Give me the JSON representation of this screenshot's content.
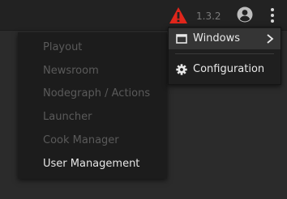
{
  "topbar": {
    "version": "1.3.2",
    "icons": {
      "warning": "warning-triangle-icon",
      "account": "account-circle-icon",
      "more": "more-vertical-icon"
    },
    "colors": {
      "warning": "#e0261b",
      "version_text": "#7a7a7a"
    }
  },
  "main_menu": {
    "items": [
      {
        "label": "Windows",
        "icon": "window-icon",
        "has_submenu": true,
        "highlighted": true
      },
      {
        "label": "Configuration",
        "icon": "gear-icon",
        "has_submenu": false,
        "highlighted": false
      }
    ]
  },
  "windows_submenu": {
    "items": [
      {
        "label": "Playout",
        "enabled": false
      },
      {
        "label": "Newsroom",
        "enabled": false
      },
      {
        "label": "Nodegraph / Actions",
        "enabled": false
      },
      {
        "label": "Launcher",
        "enabled": false
      },
      {
        "label": "Cook Manager",
        "enabled": false
      },
      {
        "label": "User Management",
        "enabled": true
      }
    ]
  }
}
